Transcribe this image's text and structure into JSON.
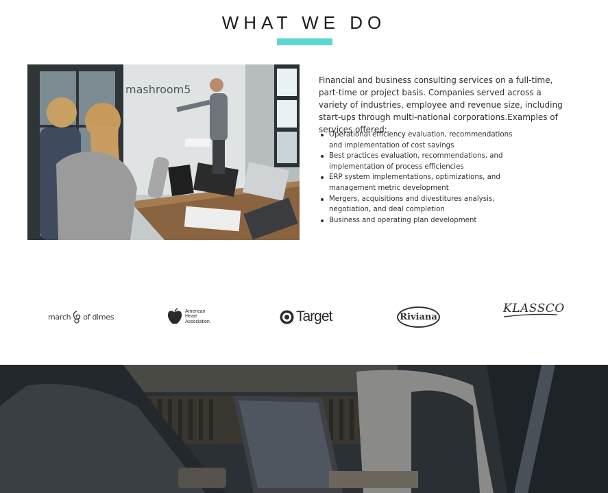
{
  "section": {
    "title": "WHAT WE DO",
    "accent_color": "#5ad8d0"
  },
  "intro": {
    "text": "Financial and business consulting services on a full-time, part-time or project basis.  Companies served across a variety of industries, employee and revenue size, including start-ups through multi-national corporations.Examples of services offered:"
  },
  "services": [
    "Operational efficiency evaluation, recommendations and implementation of cost savings",
    "Best practices evaluation, recommendations, and implementation of process efficiencies",
    "ERP system implementations, optimizations, and management metric development",
    "Mergers, acquisitions and divestitures analysis, negotiation, and deal completion",
    "Business and operating plan development"
  ],
  "photo": {
    "wall_sign": "mashroom5"
  },
  "clients": {
    "march_of_dimes": {
      "left": "march",
      "right": "of dimes",
      "icon": "swirl-icon"
    },
    "aha": {
      "line1": "American",
      "line2": "Heart",
      "line3": "Association.",
      "icon": "apple-heart-icon"
    },
    "target": {
      "name": "Target",
      "icon": "bullseye-icon"
    },
    "riviana": {
      "name": "Riviana"
    },
    "klassco": {
      "name": "KLASSCO"
    }
  },
  "colors": {
    "overlay": "#2b3034"
  }
}
